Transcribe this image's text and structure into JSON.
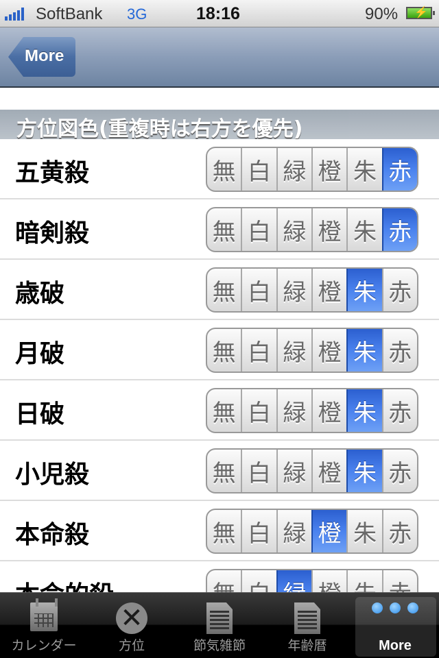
{
  "status_bar": {
    "carrier": "SoftBank",
    "network": "3G",
    "time": "18:16",
    "battery_percent": "90%",
    "signal_bars": 5,
    "charging": true
  },
  "nav_bar": {
    "back_label": "More"
  },
  "section": {
    "title": "方位図色(重複時は右方を優先)"
  },
  "color_options": [
    "無",
    "白",
    "緑",
    "橙",
    "朱",
    "赤"
  ],
  "rows": [
    {
      "label": "五黄殺",
      "selected": "赤"
    },
    {
      "label": "暗剣殺",
      "selected": "赤"
    },
    {
      "label": "歳破",
      "selected": "朱"
    },
    {
      "label": "月破",
      "selected": "朱"
    },
    {
      "label": "日破",
      "selected": "朱"
    },
    {
      "label": "小児殺",
      "selected": "朱"
    },
    {
      "label": "本命殺",
      "selected": "橙"
    },
    {
      "label": "本命的殺",
      "selected": "緑"
    }
  ],
  "tab_bar": {
    "tabs": [
      {
        "label": "カレンダー",
        "icon": "calendar-icon",
        "active": false
      },
      {
        "label": "方位",
        "icon": "compass-icon",
        "active": false
      },
      {
        "label": "節気雑節",
        "icon": "document-icon",
        "active": false
      },
      {
        "label": "年齢暦",
        "icon": "document-icon",
        "active": false
      },
      {
        "label": "More",
        "icon": "more-dots-icon",
        "active": true
      }
    ]
  }
}
